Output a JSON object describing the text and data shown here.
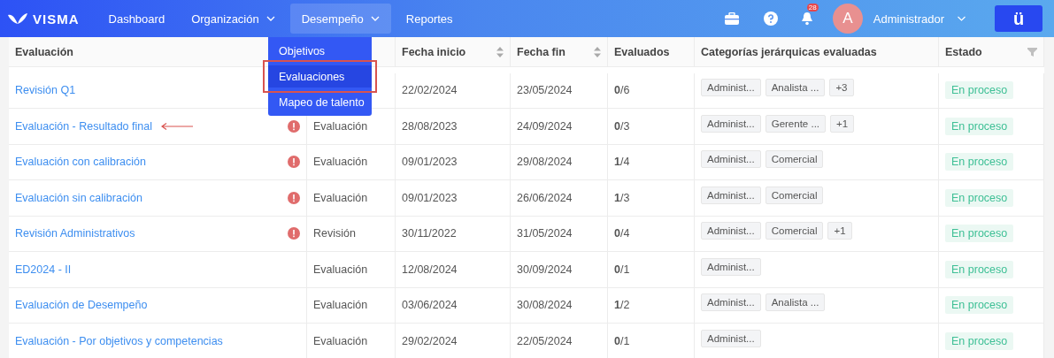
{
  "nav": {
    "logo": "VISMA",
    "items": [
      {
        "label": "Dashboard",
        "dropdown": false,
        "selected": false
      },
      {
        "label": "Organización",
        "dropdown": true,
        "selected": false
      },
      {
        "label": "Desempeño",
        "dropdown": true,
        "selected": true
      },
      {
        "label": "Reportes",
        "dropdown": false,
        "selected": false
      }
    ],
    "notifications": "28",
    "user": {
      "initial": "A",
      "name": "Administrador"
    },
    "app_button": "ü"
  },
  "menu": {
    "items": [
      {
        "label": "Objetivos",
        "selected": false,
        "highlighted": false
      },
      {
        "label": "Evaluaciones",
        "selected": true,
        "highlighted": true
      },
      {
        "label": "Mapeo de talento",
        "selected": false,
        "highlighted": false
      }
    ]
  },
  "table": {
    "columns": [
      {
        "label": "Evaluación"
      },
      {
        "label": "Fecha inicio",
        "sortable": true,
        "filter": false
      },
      {
        "label": "Fecha fin",
        "sortable": true,
        "filter": false
      },
      {
        "label": "Evaluados",
        "sortable": false,
        "filter": false
      },
      {
        "label": "Categorías jerárquicas evaluadas",
        "sortable": false,
        "filter": false
      },
      {
        "label": "Estado",
        "sortable": false,
        "filter": true
      }
    ],
    "rows": [
      {
        "name": "Revisión Q1",
        "arrow": false,
        "type": null,
        "start": "22/02/2024",
        "end": "23/05/2024",
        "evaluated": "**0**/6",
        "tags": [
          "Administ...",
          "Analista ...",
          "+3"
        ],
        "status": "En proceso"
      },
      {
        "name": "Evaluación - Resultado final",
        "warning": true,
        "arrow": true,
        "type": "Evaluación",
        "start": "28/08/2023",
        "end": "24/09/2024",
        "evaluated": "**0**/3",
        "tags": [
          "Administ...",
          "Gerente ...",
          "+1"
        ],
        "status": "En proceso"
      },
      {
        "name": "Evaluación con calibración",
        "warning": true,
        "arrow": false,
        "type": "Evaluación",
        "start": "09/01/2023",
        "end": "29/08/2024",
        "evaluated": "**1**/4",
        "tags": [
          "Administ...",
          "Comercial"
        ],
        "status": "En proceso"
      },
      {
        "name": "Evaluación sin calibración",
        "warning": true,
        "arrow": false,
        "type": "Evaluación",
        "start": "09/01/2023",
        "end": "26/06/2024",
        "evaluated": "**1**/3",
        "tags": [
          "Administ...",
          "Comercial"
        ],
        "status": "En proceso"
      },
      {
        "name": "Revisión Administrativos",
        "warning": true,
        "arrow": false,
        "type": "Revisión",
        "start": "30/11/2022",
        "end": "31/05/2024",
        "evaluated": "**0**/4",
        "tags": [
          "Administ...",
          "Comercial",
          "+1"
        ],
        "status": "En proceso"
      },
      {
        "name": "ED2024 - II",
        "warning": false,
        "arrow": false,
        "type": "Evaluación",
        "start": "12/08/2024",
        "end": "30/09/2024",
        "evaluated": "**0**/1",
        "tags": [
          "Administ..."
        ],
        "status": "En proceso"
      },
      {
        "name": "Evaluación de Desempeño",
        "warning": false,
        "arrow": false,
        "type": "Evaluación",
        "start": "03/06/2024",
        "end": "30/08/2024",
        "evaluated": "**1**/2",
        "tags": [
          "Administ...",
          "Analista ..."
        ],
        "status": "En proceso"
      },
      {
        "name": "Evaluación - Por objetivos y competencias",
        "warning": false,
        "arrow": false,
        "type": "Evaluación",
        "start": "29/02/2024",
        "end": "22/05/2024",
        "evaluated": "**0**/1",
        "tags": [
          "Administ..."
        ],
        "status": "En proceso"
      }
    ]
  }
}
